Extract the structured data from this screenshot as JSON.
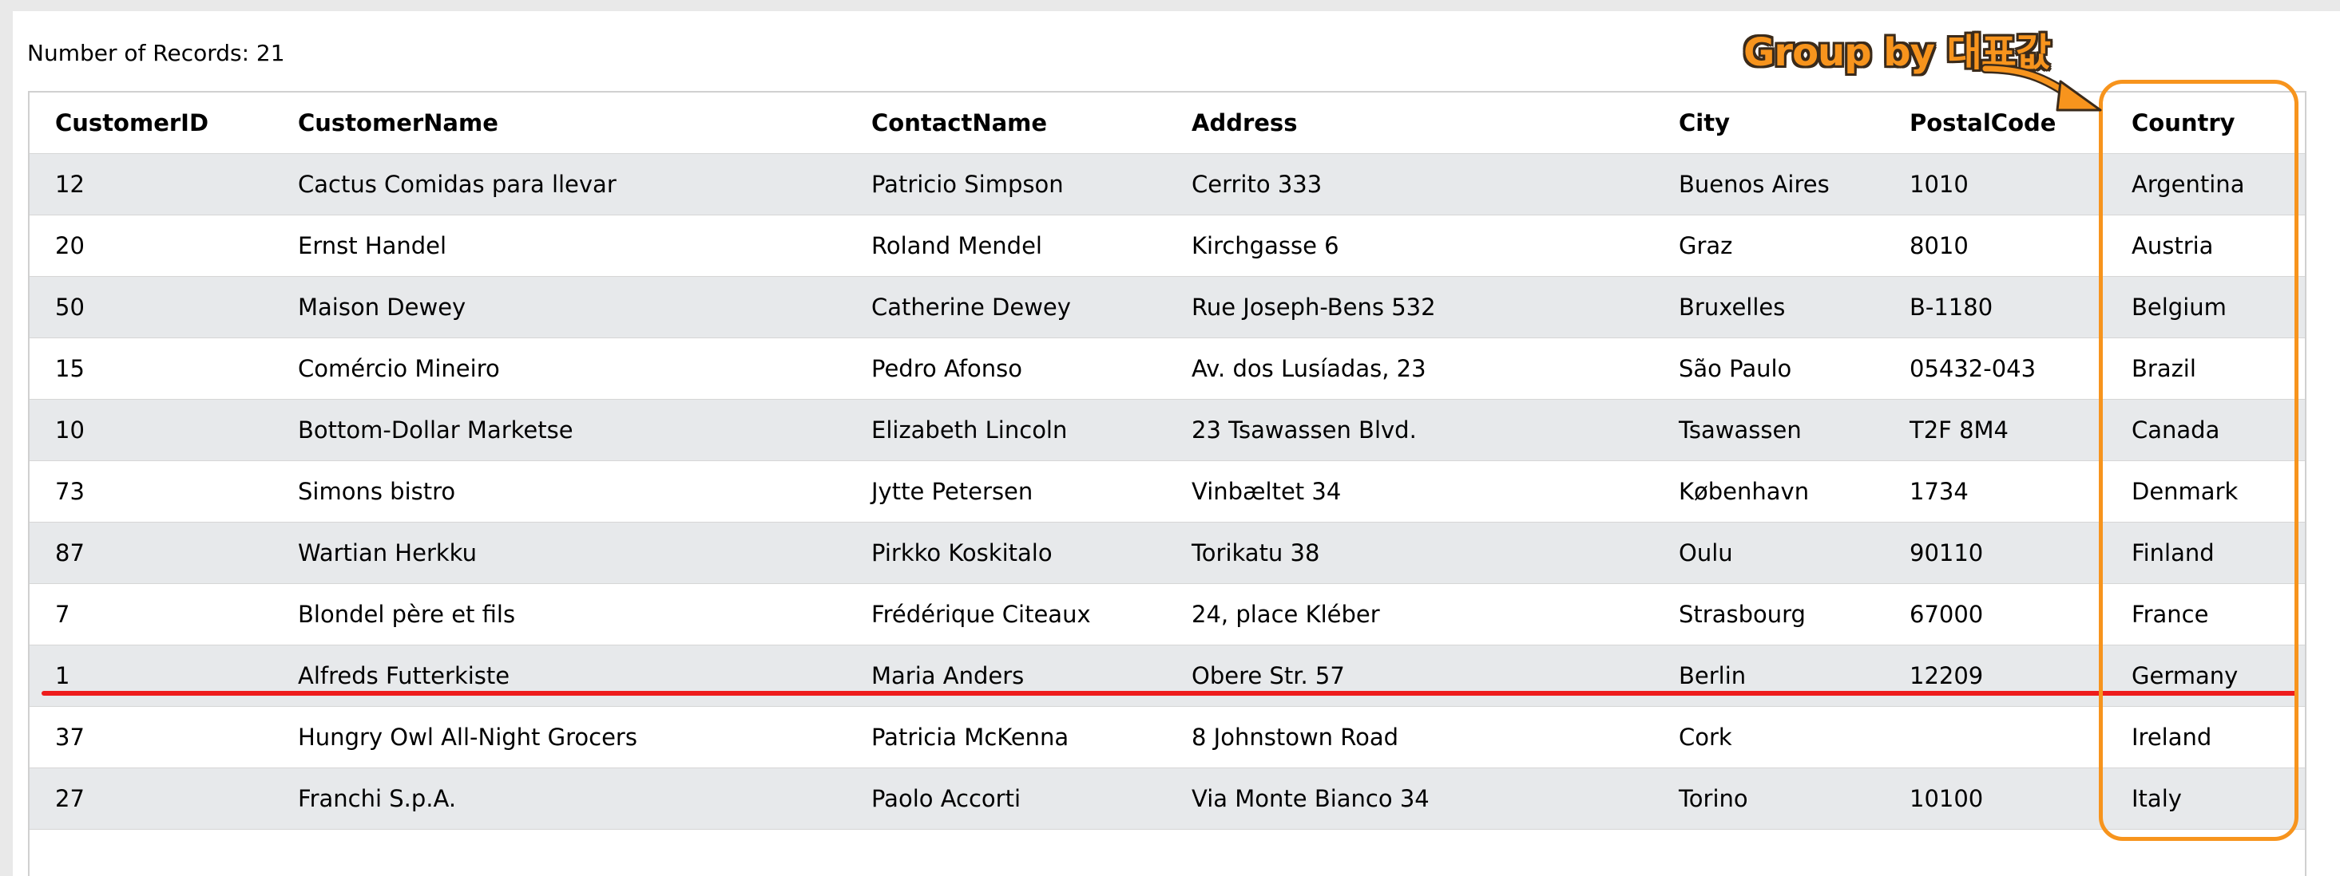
{
  "record_count_text": "Number of Records: 21",
  "annotation": {
    "text": "Group by 대표값",
    "color": "#f7941d",
    "highlight_line_color": "#ee1c1c"
  },
  "table": {
    "columns": [
      "CustomerID",
      "CustomerName",
      "ContactName",
      "Address",
      "City",
      "PostalCode",
      "Country"
    ],
    "rows": [
      [
        "12",
        "Cactus Comidas para llevar",
        "Patricio Simpson",
        "Cerrito 333",
        "Buenos Aires",
        "1010",
        "Argentina"
      ],
      [
        "20",
        "Ernst Handel",
        "Roland Mendel",
        "Kirchgasse 6",
        "Graz",
        "8010",
        "Austria"
      ],
      [
        "50",
        "Maison Dewey",
        "Catherine Dewey",
        "Rue Joseph-Bens 532",
        "Bruxelles",
        "B-1180",
        "Belgium"
      ],
      [
        "15",
        "Comércio Mineiro",
        "Pedro Afonso",
        "Av. dos Lusíadas, 23",
        "São Paulo",
        "05432-043",
        "Brazil"
      ],
      [
        "10",
        "Bottom-Dollar Marketse",
        "Elizabeth Lincoln",
        "23 Tsawassen Blvd.",
        "Tsawassen",
        "T2F 8M4",
        "Canada"
      ],
      [
        "73",
        "Simons bistro",
        "Jytte Petersen",
        "Vinbæltet 34",
        "København",
        "1734",
        "Denmark"
      ],
      [
        "87",
        "Wartian Herkku",
        "Pirkko Koskitalo",
        "Torikatu 38",
        "Oulu",
        "90110",
        "Finland"
      ],
      [
        "7",
        "Blondel père et fils",
        "Frédérique Citeaux",
        "24, place Kléber",
        "Strasbourg",
        "67000",
        "France"
      ],
      [
        "1",
        "Alfreds Futterkiste",
        "Maria Anders",
        "Obere Str. 57",
        "Berlin",
        "12209",
        "Germany"
      ],
      [
        "37",
        "Hungry Owl All-Night Grocers",
        "Patricia McKenna",
        "8 Johnstown Road",
        "Cork",
        "",
        "Ireland"
      ],
      [
        "27",
        "Franchi S.p.A.",
        "Paolo Accorti",
        "Via Monte Bianco 34",
        "Torino",
        "10100",
        "Italy"
      ]
    ]
  }
}
